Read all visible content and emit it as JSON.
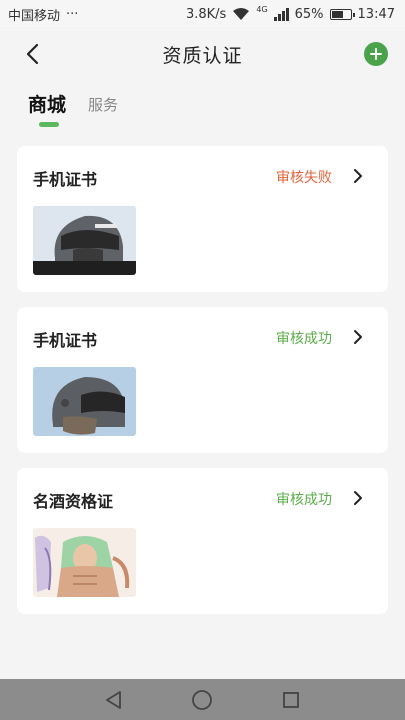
{
  "status_bar": {
    "carrier": "中国移动",
    "dots": "···",
    "speed": "3.8K/s",
    "network": "4G",
    "battery": "65%",
    "battery_level": 0.65,
    "time": "13:47"
  },
  "header": {
    "title": "资质认证"
  },
  "tabs": [
    {
      "label": "商城",
      "active": true
    },
    {
      "label": "服务",
      "active": false
    }
  ],
  "cards": [
    {
      "title": "手机证书",
      "status": "审核失败",
      "status_type": "fail",
      "image": "helmet-photo"
    },
    {
      "title": "手机证书",
      "status": "审核成功",
      "status_type": "success",
      "image": "helmet-photo"
    },
    {
      "title": "名酒资格证",
      "status": "审核成功",
      "status_type": "success",
      "image": "anime-illustration"
    }
  ],
  "colors": {
    "accent": "#5cb85c",
    "fail": "#e2643b",
    "success": "#5cad4a"
  }
}
